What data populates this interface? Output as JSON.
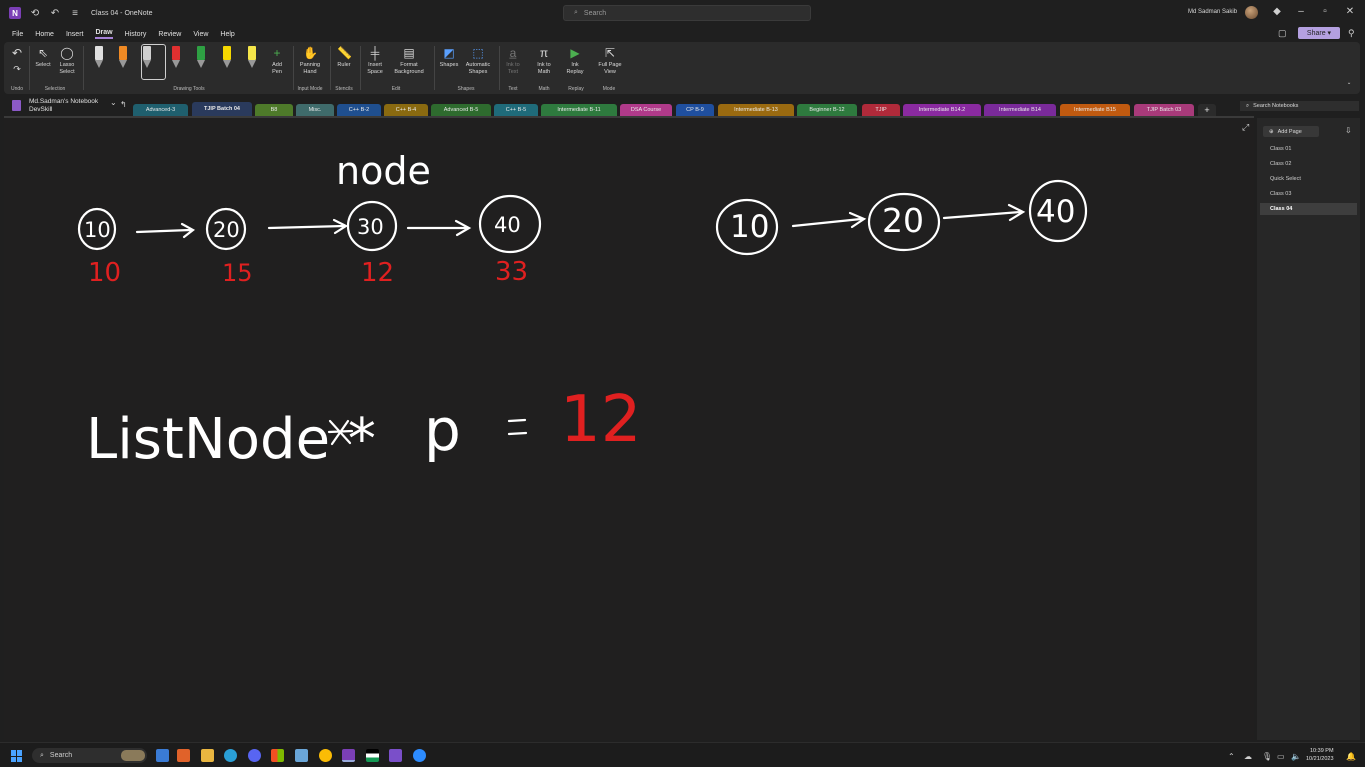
{
  "window": {
    "title": "Class 04 - OneNote",
    "search_placeholder": "Search",
    "user_name": "Md Sadman Sakib"
  },
  "menu": {
    "items": [
      "File",
      "Home",
      "Insert",
      "Draw",
      "History",
      "Review",
      "View",
      "Help"
    ],
    "active": "Draw",
    "share_label": "Share"
  },
  "ribbon": {
    "undo": "Undo",
    "select": "Select",
    "lasso": "Lasso Select",
    "add_pen": "Add Pen",
    "panning": "Panning Hand",
    "ruler": "Ruler",
    "insert_space": "Insert Space",
    "format_bg": "Format Background",
    "shapes": "Shapes",
    "auto_shapes": "Automatic Shapes",
    "ink_to_text": "Ink to Text",
    "ink_to_math": "Ink to Math",
    "ink_replay": "Ink Replay",
    "full_page": "Full Page View",
    "groups": {
      "undo": "Undo",
      "selection": "Selection",
      "drawing_tools": "Drawing Tools",
      "input_mode": "Input Mode",
      "stencils": "Stencils",
      "edit": "Edit",
      "shapes": "Shapes",
      "text": "Text",
      "math": "Math",
      "replay": "Replay",
      "mode": "Mode"
    },
    "pen_colors": [
      "#e0e0e0",
      "#f08a24",
      "#d0d0d0",
      "#ffffff",
      "#e03030",
      "#2ea043",
      "#f5d800",
      "#f5e64a"
    ]
  },
  "notebook": {
    "name": "Md.Sadman's Notebook",
    "section_group": "DevSkill",
    "sections": [
      {
        "label": "Advanced-3",
        "color": "#1f5f6e"
      },
      {
        "label": "TJIP Batch 04",
        "color": "#2a3a5c"
      },
      {
        "label": "B8",
        "color": "#4e7a2a"
      },
      {
        "label": "Misc.",
        "color": "#3f6b6b"
      },
      {
        "label": "C++ B-2",
        "color": "#1f4f8f"
      },
      {
        "label": "C++ B-4",
        "color": "#8a6a10"
      },
      {
        "label": "Advanced B-5",
        "color": "#2e6b2e"
      },
      {
        "label": "C++ B-5",
        "color": "#1f6b7a"
      },
      {
        "label": "Intermediate B-11",
        "color": "#2e7a3e"
      },
      {
        "label": "DSA Course",
        "color": "#b03a8a"
      },
      {
        "label": "CP B-9",
        "color": "#1f4f9f"
      },
      {
        "label": "Intermediate B-13",
        "color": "#9a6a10"
      },
      {
        "label": "Beginner B-12",
        "color": "#2e7a3e"
      },
      {
        "label": "TJIP",
        "color": "#b02a3a"
      },
      {
        "label": "Intermediate B14.2",
        "color": "#8a2aa0"
      },
      {
        "label": "Intermediate B14",
        "color": "#7a2a9a"
      },
      {
        "label": "Intermediate B15",
        "color": "#c05a10"
      },
      {
        "label": "TJIP Batch 03",
        "color": "#a83a7a"
      }
    ],
    "search_label": "Search Notebooks"
  },
  "pages": {
    "add_label": "Add Page",
    "items": [
      "Class 01",
      "Class 02",
      "Quick Select",
      "Class 03",
      "Class 04"
    ],
    "active_index": 4
  },
  "ink": {
    "label_node": "node",
    "list1_values": [
      "10",
      "20",
      "30",
      "40"
    ],
    "list1_addresses": [
      "10",
      "15",
      "12",
      "33"
    ],
    "list2_values": [
      "10",
      "20",
      "40"
    ],
    "declaration": "ListNode *",
    "variable": "p",
    "equals": "=",
    "assigned": "12",
    "ink_color": "#ffffff",
    "accent_color": "#e02020"
  },
  "taskbar": {
    "search_label": "Search",
    "time": "10:39 PM",
    "date": "10/21/2023"
  }
}
